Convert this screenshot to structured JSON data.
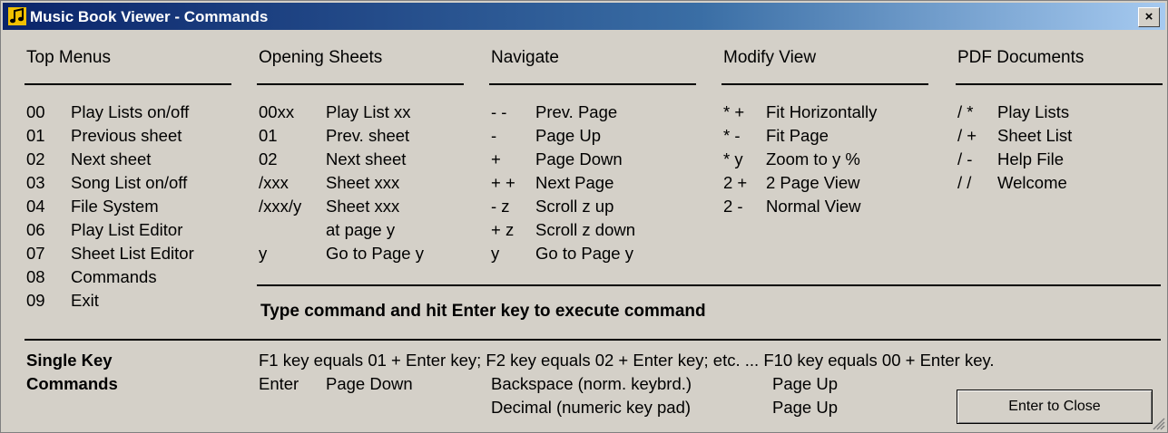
{
  "window": {
    "title": "Music Book Viewer - Commands",
    "close_glyph": "×"
  },
  "columns": [
    {
      "header": "Top Menus",
      "rows": [
        [
          "00",
          "Play Lists on/off"
        ],
        [
          "01",
          "Previous sheet"
        ],
        [
          "02",
          "Next sheet"
        ],
        [
          "03",
          "Song List on/off"
        ],
        [
          "04",
          "File System"
        ],
        [
          "06",
          "Play List Editor"
        ],
        [
          "07",
          "Sheet List Editor"
        ],
        [
          "08",
          "Commands"
        ],
        [
          "09",
          "Exit"
        ]
      ]
    },
    {
      "header": "Opening Sheets",
      "rows": [
        [
          "00xx",
          "Play List xx"
        ],
        [
          "01",
          "Prev. sheet"
        ],
        [
          "02",
          "Next sheet"
        ],
        [
          "/xxx",
          "Sheet xxx"
        ],
        [
          "/xxx/y",
          "Sheet xxx"
        ],
        [
          "",
          "at page y"
        ],
        [
          "y",
          "Go to Page y"
        ]
      ]
    },
    {
      "header": "Navigate",
      "rows": [
        [
          "- -",
          "Prev. Page"
        ],
        [
          "-",
          "Page Up"
        ],
        [
          "+",
          "Page Down"
        ],
        [
          "+ +",
          "Next Page"
        ],
        [
          "- z",
          "Scroll z up"
        ],
        [
          "+ z",
          "Scroll z down"
        ],
        [
          "y",
          "Go to Page y"
        ]
      ]
    },
    {
      "header": "Modify View",
      "rows": [
        [
          "* +",
          "Fit Horizontally"
        ],
        [
          "* -",
          "Fit Page"
        ],
        [
          "* y",
          "Zoom to y %"
        ],
        [
          "2 +",
          "2 Page View"
        ],
        [
          "2 -",
          "Normal View"
        ]
      ]
    },
    {
      "header": "PDF Documents",
      "rows": [
        [
          "/ *",
          "Play Lists"
        ],
        [
          "/ +",
          "Sheet List"
        ],
        [
          "/ -",
          "Help File"
        ],
        [
          "/ /",
          "Welcome"
        ]
      ]
    }
  ],
  "instruction": "Type command and hit Enter key to execute command",
  "single_key": {
    "heading_line1": "Single Key",
    "heading_line2": "Commands",
    "fkeys": "F1 key equals 01 + Enter key; F2 key equals 02 + Enter key; etc. ... F10 key equals 00 + Enter key.",
    "enter_key": "Enter",
    "enter_action": "Page Down",
    "backspace_key": "Backspace (norm. keybrd.)",
    "backspace_action": "Page Up",
    "decimal_key": "Decimal (numeric key pad)",
    "decimal_action": "Page Up"
  },
  "close_button": {
    "label": "Enter to Close"
  }
}
